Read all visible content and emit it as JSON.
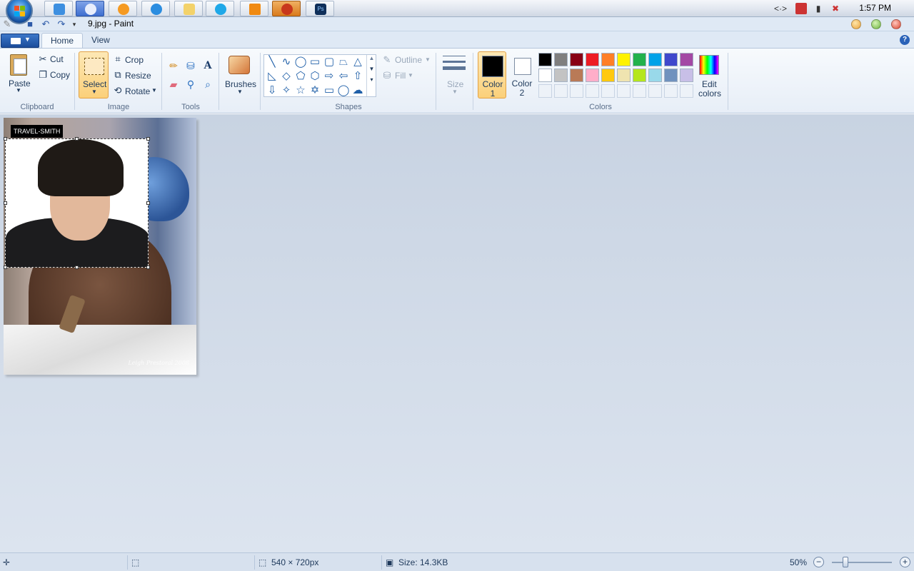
{
  "taskbar": {
    "clock": "1:57 PM",
    "pinned": [
      "desktop-icon",
      "paint-icon",
      "media-player-icon",
      "ie-icon",
      "explorer-icon",
      "skype-icon",
      "vlc-icon",
      "firefox-icon",
      "photoshop-icon"
    ],
    "photoshop_label": "Ps"
  },
  "title": {
    "text": "9.jpg - Paint"
  },
  "tabs": {
    "home": "Home",
    "view": "View"
  },
  "ribbon": {
    "clipboard": {
      "group": "Clipboard",
      "paste": "Paste",
      "cut": "Cut",
      "copy": "Copy"
    },
    "image": {
      "group": "Image",
      "select": "Select",
      "crop": "Crop",
      "resize": "Resize",
      "rotate": "Rotate"
    },
    "tools": {
      "group": "Tools"
    },
    "brushes": {
      "label": "Brushes"
    },
    "shapes": {
      "group": "Shapes",
      "outline": "Outline",
      "fill": "Fill"
    },
    "size": {
      "label": "Size"
    },
    "colors": {
      "group": "Colors",
      "color1": "Color",
      "color1_num": "1",
      "color2": "Color",
      "color2_num": "2",
      "edit": "Edit",
      "edit2": "colors",
      "color1_value": "#000000",
      "color2_value": "#ffffff",
      "palette_row1": [
        "#000000",
        "#7f7f7f",
        "#880015",
        "#ed1c24",
        "#ff7f27",
        "#fff200",
        "#22b14c",
        "#00a2e8",
        "#3f48cc",
        "#a349a4"
      ],
      "palette_row2": [
        "#ffffff",
        "#c3c3c3",
        "#b97a57",
        "#ffaec9",
        "#ffc90e",
        "#efe4b0",
        "#b5e61d",
        "#99d9ea",
        "#7092be",
        "#c8bfe7"
      ]
    }
  },
  "canvas": {
    "logo_text": "TRAVEL-SMITH",
    "watermark": "Leigh Prestoral 2008"
  },
  "status": {
    "dimensions": "540 × 720px",
    "size": "Size: 14.3KB",
    "zoom": "50%"
  }
}
